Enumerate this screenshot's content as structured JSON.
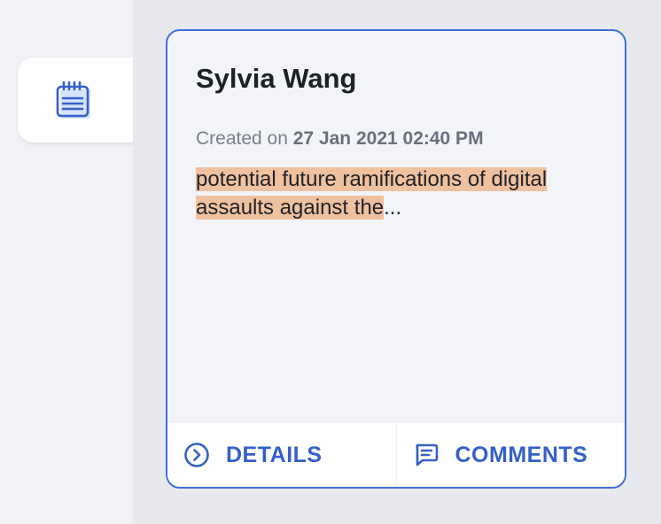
{
  "sidebar": {
    "active_icon": "notepad-icon"
  },
  "card": {
    "title": "Sylvia Wang",
    "created_prefix": "Created on",
    "created_date": "27 Jan 2021 02:40 PM",
    "excerpt_highlighted": "potential future ramifications of digital assaults against the",
    "excerpt_ellipsis": "...",
    "details_label": "DETAILS",
    "details_icon": "chevron-circle-right-icon",
    "comments_label": "COMMENTS",
    "comments_icon": "message-icon"
  },
  "colors": {
    "accent": "#3560c9",
    "highlight": "#f0c19e",
    "card_border": "#3f6fd8"
  }
}
